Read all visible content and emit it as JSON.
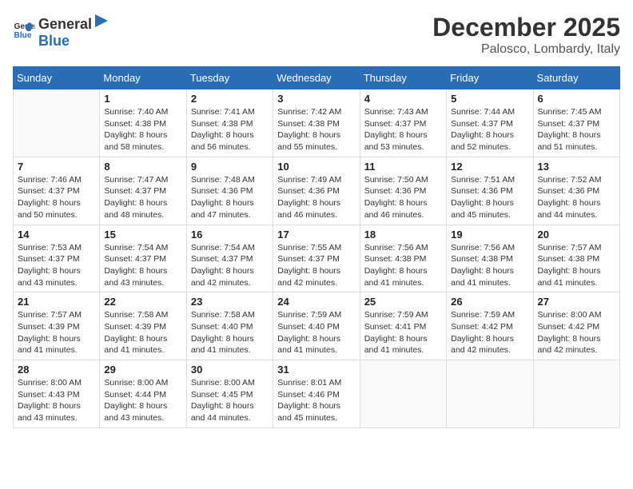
{
  "header": {
    "logo_general": "General",
    "logo_blue": "Blue",
    "month": "December 2025",
    "location": "Palosco, Lombardy, Italy"
  },
  "weekdays": [
    "Sunday",
    "Monday",
    "Tuesday",
    "Wednesday",
    "Thursday",
    "Friday",
    "Saturday"
  ],
  "weeks": [
    [
      {
        "day": "",
        "sunrise": "",
        "sunset": "",
        "daylight": ""
      },
      {
        "day": "1",
        "sunrise": "Sunrise: 7:40 AM",
        "sunset": "Sunset: 4:38 PM",
        "daylight": "Daylight: 8 hours and 58 minutes."
      },
      {
        "day": "2",
        "sunrise": "Sunrise: 7:41 AM",
        "sunset": "Sunset: 4:38 PM",
        "daylight": "Daylight: 8 hours and 56 minutes."
      },
      {
        "day": "3",
        "sunrise": "Sunrise: 7:42 AM",
        "sunset": "Sunset: 4:38 PM",
        "daylight": "Daylight: 8 hours and 55 minutes."
      },
      {
        "day": "4",
        "sunrise": "Sunrise: 7:43 AM",
        "sunset": "Sunset: 4:37 PM",
        "daylight": "Daylight: 8 hours and 53 minutes."
      },
      {
        "day": "5",
        "sunrise": "Sunrise: 7:44 AM",
        "sunset": "Sunset: 4:37 PM",
        "daylight": "Daylight: 8 hours and 52 minutes."
      },
      {
        "day": "6",
        "sunrise": "Sunrise: 7:45 AM",
        "sunset": "Sunset: 4:37 PM",
        "daylight": "Daylight: 8 hours and 51 minutes."
      }
    ],
    [
      {
        "day": "7",
        "sunrise": "Sunrise: 7:46 AM",
        "sunset": "Sunset: 4:37 PM",
        "daylight": "Daylight: 8 hours and 50 minutes."
      },
      {
        "day": "8",
        "sunrise": "Sunrise: 7:47 AM",
        "sunset": "Sunset: 4:37 PM",
        "daylight": "Daylight: 8 hours and 48 minutes."
      },
      {
        "day": "9",
        "sunrise": "Sunrise: 7:48 AM",
        "sunset": "Sunset: 4:36 PM",
        "daylight": "Daylight: 8 hours and 47 minutes."
      },
      {
        "day": "10",
        "sunrise": "Sunrise: 7:49 AM",
        "sunset": "Sunset: 4:36 PM",
        "daylight": "Daylight: 8 hours and 46 minutes."
      },
      {
        "day": "11",
        "sunrise": "Sunrise: 7:50 AM",
        "sunset": "Sunset: 4:36 PM",
        "daylight": "Daylight: 8 hours and 46 minutes."
      },
      {
        "day": "12",
        "sunrise": "Sunrise: 7:51 AM",
        "sunset": "Sunset: 4:36 PM",
        "daylight": "Daylight: 8 hours and 45 minutes."
      },
      {
        "day": "13",
        "sunrise": "Sunrise: 7:52 AM",
        "sunset": "Sunset: 4:36 PM",
        "daylight": "Daylight: 8 hours and 44 minutes."
      }
    ],
    [
      {
        "day": "14",
        "sunrise": "Sunrise: 7:53 AM",
        "sunset": "Sunset: 4:37 PM",
        "daylight": "Daylight: 8 hours and 43 minutes."
      },
      {
        "day": "15",
        "sunrise": "Sunrise: 7:54 AM",
        "sunset": "Sunset: 4:37 PM",
        "daylight": "Daylight: 8 hours and 43 minutes."
      },
      {
        "day": "16",
        "sunrise": "Sunrise: 7:54 AM",
        "sunset": "Sunset: 4:37 PM",
        "daylight": "Daylight: 8 hours and 42 minutes."
      },
      {
        "day": "17",
        "sunrise": "Sunrise: 7:55 AM",
        "sunset": "Sunset: 4:37 PM",
        "daylight": "Daylight: 8 hours and 42 minutes."
      },
      {
        "day": "18",
        "sunrise": "Sunrise: 7:56 AM",
        "sunset": "Sunset: 4:38 PM",
        "daylight": "Daylight: 8 hours and 41 minutes."
      },
      {
        "day": "19",
        "sunrise": "Sunrise: 7:56 AM",
        "sunset": "Sunset: 4:38 PM",
        "daylight": "Daylight: 8 hours and 41 minutes."
      },
      {
        "day": "20",
        "sunrise": "Sunrise: 7:57 AM",
        "sunset": "Sunset: 4:38 PM",
        "daylight": "Daylight: 8 hours and 41 minutes."
      }
    ],
    [
      {
        "day": "21",
        "sunrise": "Sunrise: 7:57 AM",
        "sunset": "Sunset: 4:39 PM",
        "daylight": "Daylight: 8 hours and 41 minutes."
      },
      {
        "day": "22",
        "sunrise": "Sunrise: 7:58 AM",
        "sunset": "Sunset: 4:39 PM",
        "daylight": "Daylight: 8 hours and 41 minutes."
      },
      {
        "day": "23",
        "sunrise": "Sunrise: 7:58 AM",
        "sunset": "Sunset: 4:40 PM",
        "daylight": "Daylight: 8 hours and 41 minutes."
      },
      {
        "day": "24",
        "sunrise": "Sunrise: 7:59 AM",
        "sunset": "Sunset: 4:40 PM",
        "daylight": "Daylight: 8 hours and 41 minutes."
      },
      {
        "day": "25",
        "sunrise": "Sunrise: 7:59 AM",
        "sunset": "Sunset: 4:41 PM",
        "daylight": "Daylight: 8 hours and 41 minutes."
      },
      {
        "day": "26",
        "sunrise": "Sunrise: 7:59 AM",
        "sunset": "Sunset: 4:42 PM",
        "daylight": "Daylight: 8 hours and 42 minutes."
      },
      {
        "day": "27",
        "sunrise": "Sunrise: 8:00 AM",
        "sunset": "Sunset: 4:42 PM",
        "daylight": "Daylight: 8 hours and 42 minutes."
      }
    ],
    [
      {
        "day": "28",
        "sunrise": "Sunrise: 8:00 AM",
        "sunset": "Sunset: 4:43 PM",
        "daylight": "Daylight: 8 hours and 43 minutes."
      },
      {
        "day": "29",
        "sunrise": "Sunrise: 8:00 AM",
        "sunset": "Sunset: 4:44 PM",
        "daylight": "Daylight: 8 hours and 43 minutes."
      },
      {
        "day": "30",
        "sunrise": "Sunrise: 8:00 AM",
        "sunset": "Sunset: 4:45 PM",
        "daylight": "Daylight: 8 hours and 44 minutes."
      },
      {
        "day": "31",
        "sunrise": "Sunrise: 8:01 AM",
        "sunset": "Sunset: 4:46 PM",
        "daylight": "Daylight: 8 hours and 45 minutes."
      },
      {
        "day": "",
        "sunrise": "",
        "sunset": "",
        "daylight": ""
      },
      {
        "day": "",
        "sunrise": "",
        "sunset": "",
        "daylight": ""
      },
      {
        "day": "",
        "sunrise": "",
        "sunset": "",
        "daylight": ""
      }
    ]
  ]
}
